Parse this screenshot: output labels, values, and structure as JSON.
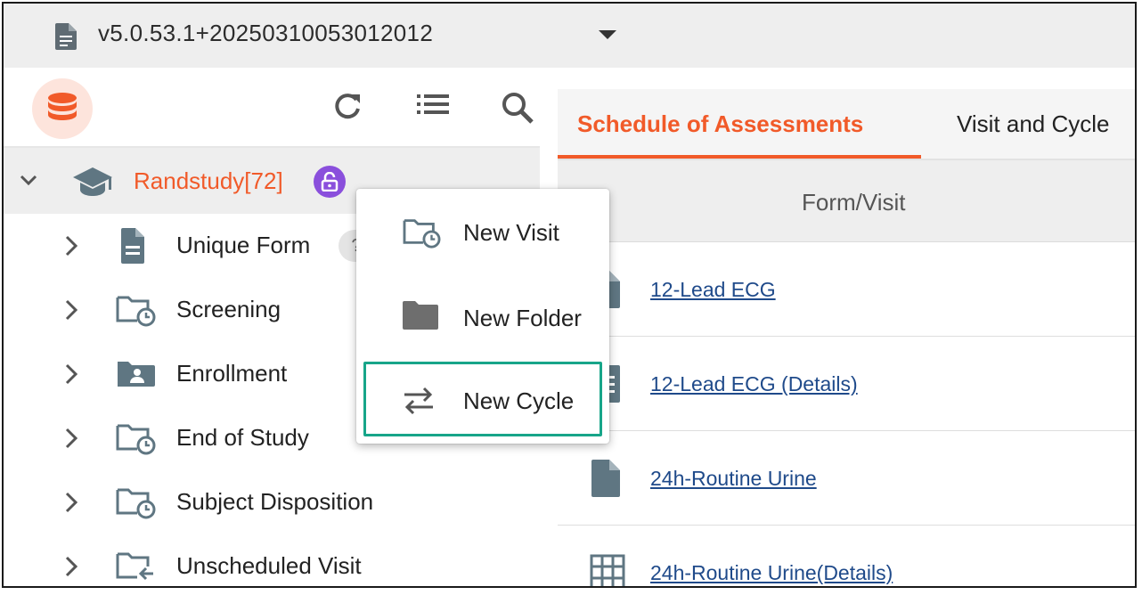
{
  "header": {
    "version": "v5.0.53.1+20250310053012012"
  },
  "tree": {
    "study": {
      "name": "Randstudy[72]"
    },
    "items": [
      {
        "label": "Unique Form",
        "icon": "form-icon",
        "badge": "?"
      },
      {
        "label": "Screening",
        "icon": "visit-folder-icon"
      },
      {
        "label": "Enrollment",
        "icon": "person-folder-icon"
      },
      {
        "label": "End of Study",
        "icon": "visit-folder-icon"
      },
      {
        "label": "Subject Disposition",
        "icon": "visit-folder-icon"
      },
      {
        "label": "Unscheduled Visit",
        "icon": "unscheduled-folder-icon"
      }
    ]
  },
  "context_menu": {
    "items": [
      {
        "label": "New Visit",
        "icon": "visit-folder-icon"
      },
      {
        "label": "New Folder",
        "icon": "folder-icon"
      },
      {
        "label": "New Cycle",
        "icon": "cycle-icon",
        "highlighted": true
      }
    ],
    "highlight_color": "#17a589"
  },
  "main": {
    "tabs": [
      {
        "label": "Schedule of Assessments",
        "active": true
      },
      {
        "label": "Visit and Cycle",
        "active": false
      }
    ],
    "column_header": "Form/Visit",
    "forms": [
      {
        "label": "12-Lead ECG",
        "icon": "form-icon"
      },
      {
        "label": "12-Lead ECG (Details)",
        "icon": "list-form-icon"
      },
      {
        "label": "24h-Routine Urine",
        "icon": "form-icon"
      },
      {
        "label": "24h-Routine Urine(Details)",
        "icon": "grid-icon"
      }
    ]
  },
  "colors": {
    "accent": "#f15a29",
    "lock_badge": "#8a4fdc",
    "icon_gray": "#5f7682",
    "link": "#1f4a8a"
  }
}
